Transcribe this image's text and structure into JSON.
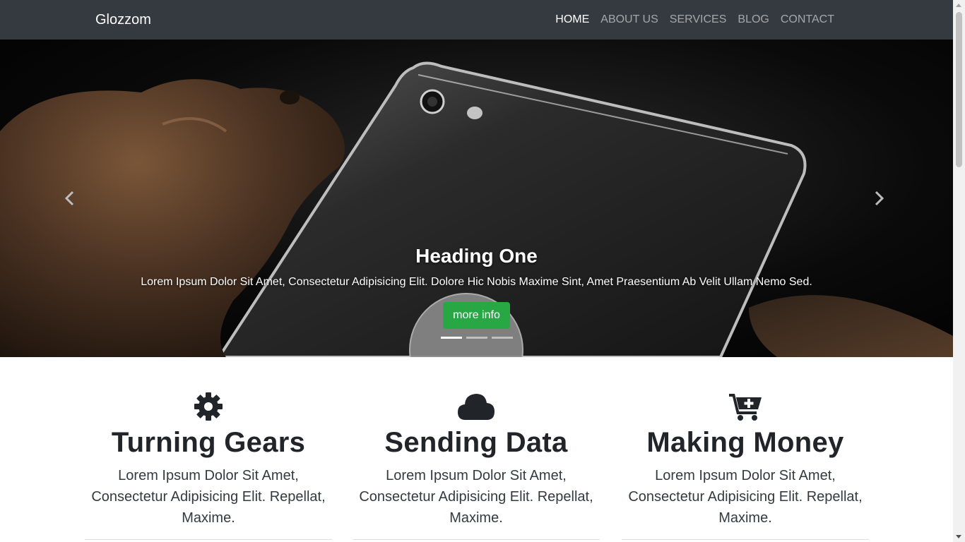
{
  "navbar": {
    "brand": "Glozzom",
    "links": [
      "HOME",
      "ABOUT US",
      "SERVICES",
      "BLOG",
      "CONTACT"
    ],
    "active": "HOME"
  },
  "carousel": {
    "heading": "Heading One",
    "text": "Lorem Ipsum Dolor Sit Amet, Consectetur Adipisicing Elit. Dolore Hic Nobis Maxime Sint, Amet Praesentium Ab Velit Ullam Nemo Sed.",
    "button_label": "more info",
    "slide_count": 3,
    "active_slide": 1,
    "prev_icon": "chevron-left-icon",
    "next_icon": "chevron-right-icon"
  },
  "features": [
    {
      "icon": "gear-icon",
      "title": "Turning Gears",
      "text": "Lorem Ipsum Dolor Sit Amet, Consectetur Adipisicing Elit. Repellat, Maxime."
    },
    {
      "icon": "cloud-icon",
      "title": "Sending Data",
      "text": "Lorem Ipsum Dolor Sit Amet, Consectetur Adipisicing Elit. Repellat, Maxime."
    },
    {
      "icon": "cart-plus-icon",
      "title": "Making Money",
      "text": "Lorem Ipsum Dolor Sit Amet, Consectetur Adipisicing Elit. Repellat, Maxime."
    }
  ],
  "colors": {
    "navbar_bg": "#343a40",
    "button_green": "#28a745",
    "text_dark": "#212529"
  }
}
